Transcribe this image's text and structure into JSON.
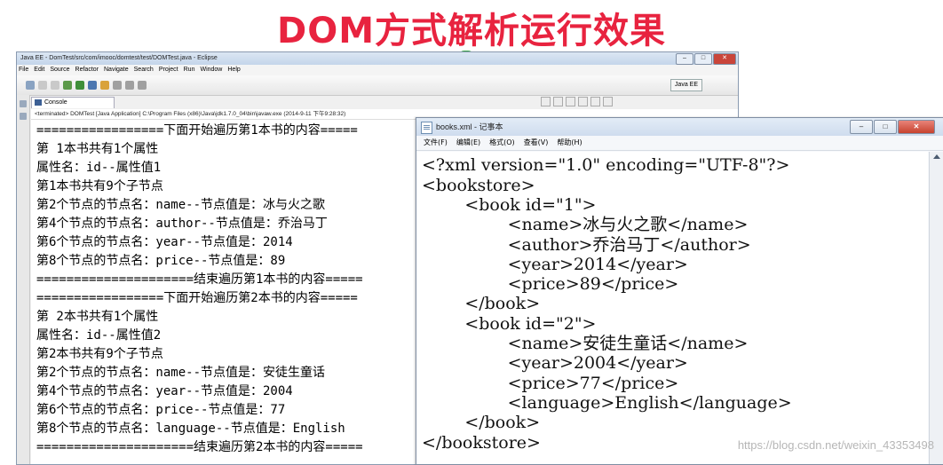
{
  "slide": {
    "title": "DOM方式解析运行效果",
    "watermark": "https://blog.csdn.net/weixin_43353498"
  },
  "eclipse": {
    "window_title": "Java EE - DomTest/src/com/imooc/domtest/test/DOMTest.java - Eclipse",
    "badge": "58",
    "menu": [
      "File",
      "Edit",
      "Source",
      "Refactor",
      "Navigate",
      "Search",
      "Project",
      "Run",
      "Window",
      "Help"
    ],
    "perspective": "Java EE",
    "console_tab": "Console",
    "terminated": "<terminated> DOMTest [Java Application] C:\\Program Files (x86)\\Java\\jdk1.7.0_04\\bin\\javaw.exe (2014-9-11 下午9:28:32)",
    "console_lines": [
      "=================下面开始遍历第1本书的内容=====",
      "第 1本书共有1个属性",
      "属性名：id--属性值1",
      "第1本书共有9个子节点",
      "第2个节点的节点名：name--节点值是：冰与火之歌",
      "第4个节点的节点名：author--节点值是：乔治马丁",
      "第6个节点的节点名：year--节点值是：2014",
      "第8个节点的节点名：price--节点值是：89",
      "=====================结束遍历第1本书的内容=====",
      "=================下面开始遍历第2本书的内容=====",
      "第 2本书共有1个属性",
      "属性名：id--属性值2",
      "第2本书共有9个子节点",
      "第2个节点的节点名：name--节点值是：安徒生童话",
      "第4个节点的节点名：year--节点值是：2004",
      "第6个节点的节点名：price--节点值是：77",
      "第8个节点的节点名：language--节点值是：English",
      "=====================结束遍历第2本书的内容====="
    ]
  },
  "notepad": {
    "window_title": "books.xml - 记事本",
    "menu": [
      "文件(F)",
      "编辑(E)",
      "格式(O)",
      "查看(V)",
      "帮助(H)"
    ],
    "lines": [
      "<?xml version=\"1.0\" encoding=\"UTF-8\"?>",
      "<bookstore>",
      "        <book id=\"1\">",
      "                <name>冰与火之歌</name>",
      "                <author>乔治马丁</author>",
      "                <year>2014</year>",
      "                <price>89</price>",
      "        </book>",
      "        <book id=\"2\">",
      "                <name>安徒生童话</name>",
      "                <year>2004</year>",
      "                <price>77</price>",
      "                <language>English</language>",
      "        </book>",
      "</bookstore>"
    ]
  }
}
